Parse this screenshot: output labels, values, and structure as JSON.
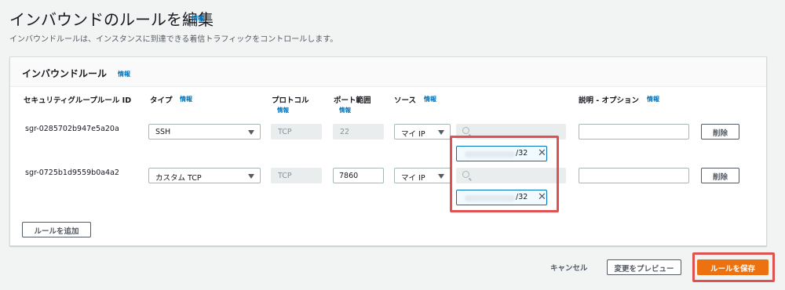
{
  "page": {
    "title": "インバウンドのルールを編集",
    "title_info": "情報",
    "subtitle": "インバウンドルールは、インスタンスに到達できる着信トラフィックをコントロールします。"
  },
  "panel": {
    "title": "インバウンドルール",
    "info": "情報",
    "columns": {
      "rule_id": "セキュリティグループルール ID",
      "type": "タイプ",
      "type_info": "情報",
      "protocol": "プロトコル",
      "protocol_info": "情報",
      "port": "ポート範囲",
      "port_info": "情報",
      "source": "ソース",
      "source_info": "情報",
      "description": "説明 - オプション",
      "description_info": "情報"
    },
    "rows": [
      {
        "rule_id": "sgr-0285702b947e5a20a",
        "type": "SSH",
        "protocol": "TCP",
        "port": "22",
        "source_type": "マイ IP",
        "search_placeholder": "",
        "token_cidr": "/32",
        "description": "",
        "delete_label": "削除"
      },
      {
        "rule_id": "sgr-0725b1d9559b0a4a2",
        "type": "カスタム TCP",
        "protocol": "TCP",
        "port": "7860",
        "source_type": "マイ IP",
        "search_placeholder": "",
        "token_cidr": "/32",
        "description": "",
        "delete_label": "削除"
      }
    ],
    "add_rule_label": "ルールを追加"
  },
  "footer": {
    "cancel_label": "キャンセル",
    "preview_label": "変更をプレビュー",
    "save_label": "ルールを保存"
  },
  "colors": {
    "accent": "#ec7211",
    "link": "#0073bb",
    "highlight": "#e05252"
  }
}
